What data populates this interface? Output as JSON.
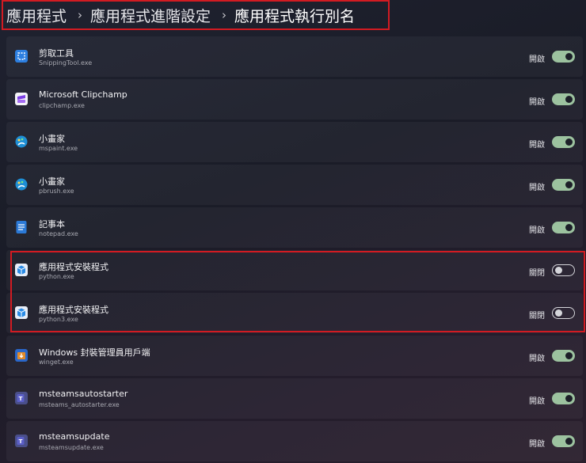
{
  "breadcrumb": {
    "items": [
      "應用程式",
      "應用程式進階設定",
      "應用程式執行別名"
    ],
    "separator": "›"
  },
  "apps": [
    {
      "name": "剪取工具",
      "exe": "SnippingTool.exe",
      "state": "開啟",
      "on": true,
      "icon": "snipping-tool-icon",
      "color": "#2d7fe0"
    },
    {
      "name": "Microsoft Clipchamp",
      "exe": "clipchamp.exe",
      "state": "開啟",
      "on": true,
      "icon": "clipchamp-icon",
      "color": "#7b3fe4"
    },
    {
      "name": "小畫家",
      "exe": "mspaint.exe",
      "state": "開啟",
      "on": true,
      "icon": "paint-icon",
      "color": "#1e8fd6"
    },
    {
      "name": "小畫家",
      "exe": "pbrush.exe",
      "state": "開啟",
      "on": true,
      "icon": "paint-icon",
      "color": "#1e8fd6"
    },
    {
      "name": "記事本",
      "exe": "notepad.exe",
      "state": "開啟",
      "on": true,
      "icon": "notepad-icon",
      "color": "#2b79d6"
    },
    {
      "name": "應用程式安裝程式",
      "exe": "python.exe",
      "state": "關閉",
      "on": false,
      "icon": "app-installer-icon",
      "color": "#2a8be6"
    },
    {
      "name": "應用程式安裝程式",
      "exe": "python3.exe",
      "state": "關閉",
      "on": false,
      "icon": "app-installer-icon",
      "color": "#2a8be6"
    },
    {
      "name": "Windows 封裝管理員用戶端",
      "exe": "winget.exe",
      "state": "開啟",
      "on": true,
      "icon": "package-manager-icon",
      "color": "#e08a2a"
    },
    {
      "name": "msteamsautostarter",
      "exe": "msteams_autostarter.exe",
      "state": "開啟",
      "on": true,
      "icon": "teams-icon",
      "color": "#5b5fc7"
    },
    {
      "name": "msteamsupdate",
      "exe": "msteamsupdate.exe",
      "state": "開啟",
      "on": true,
      "icon": "teams-icon",
      "color": "#5b5fc7"
    }
  ],
  "colors": {
    "toggle_on": "#9cc29f",
    "highlight": "#d21b22"
  }
}
